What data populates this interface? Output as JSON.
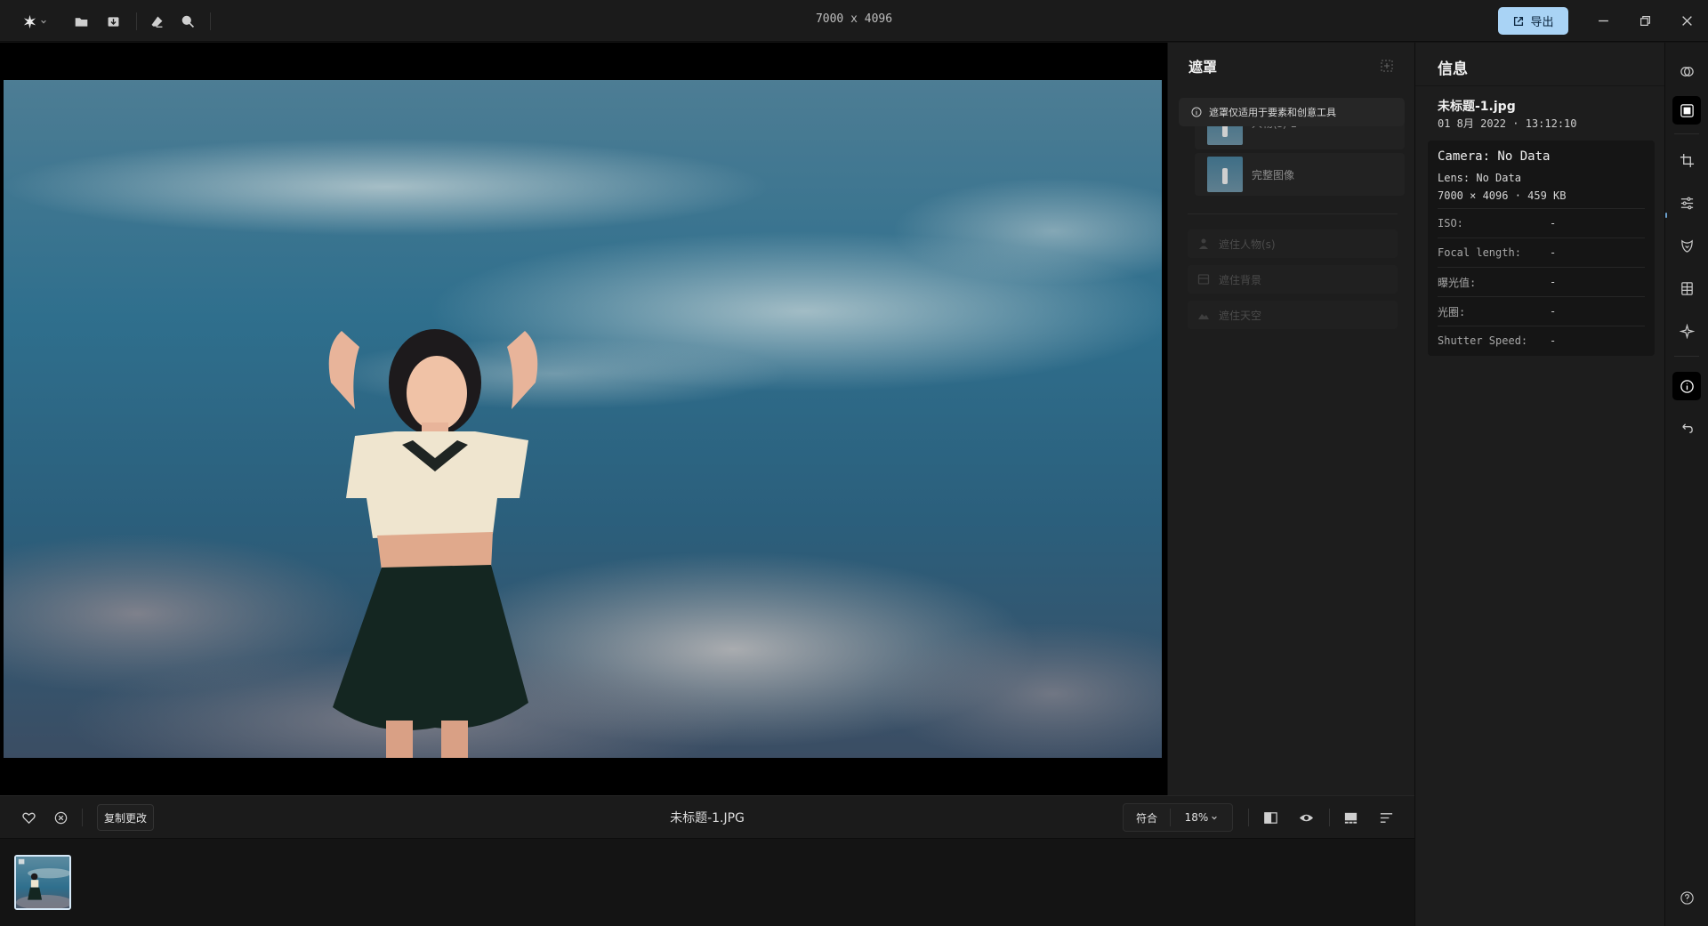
{
  "topbar": {
    "dimensions": "7000 x 4096",
    "export_label": "导出",
    "icons": [
      "app-logo-icon",
      "folder-icon",
      "import-icon",
      "eraser-icon",
      "search-icon"
    ]
  },
  "canvas": {
    "image_description_icon": "photo-canvas"
  },
  "mask_panel": {
    "title": "遮罩",
    "notice": "遮罩仅适用于要素和创意工具",
    "cards": [
      {
        "label": "人物(s) 1"
      },
      {
        "label": "完整图像"
      }
    ],
    "actions": [
      {
        "label": "遮住人物(s)",
        "icon": "person-icon"
      },
      {
        "label": "遮住背景",
        "icon": "background-icon"
      },
      {
        "label": "遮住天空",
        "icon": "sky-icon"
      }
    ]
  },
  "info_panel": {
    "title": "信息",
    "filename": "未标题-1.jpg",
    "date": "01 8月 2022 · 13:12:10",
    "camera": "Camera: No Data",
    "lens": "Lens: No Data",
    "size": "7000 × 4096 · 459 KB",
    "exif": [
      {
        "key": "ISO:",
        "value": "-"
      },
      {
        "key": "Focal length:",
        "value": "-"
      },
      {
        "key": "曝光值:",
        "value": "-"
      },
      {
        "key": "光圈:",
        "value": "-"
      },
      {
        "key": "Shutter Speed:",
        "value": "-"
      }
    ]
  },
  "bottombar": {
    "copy_changes": "复制更改",
    "filename": "未标题-1.JPG",
    "fit": "符合",
    "zoom": "18%"
  },
  "colors": {
    "accent": "#a9d3f5",
    "panel": "#1d1d1d",
    "background": "#141414"
  }
}
